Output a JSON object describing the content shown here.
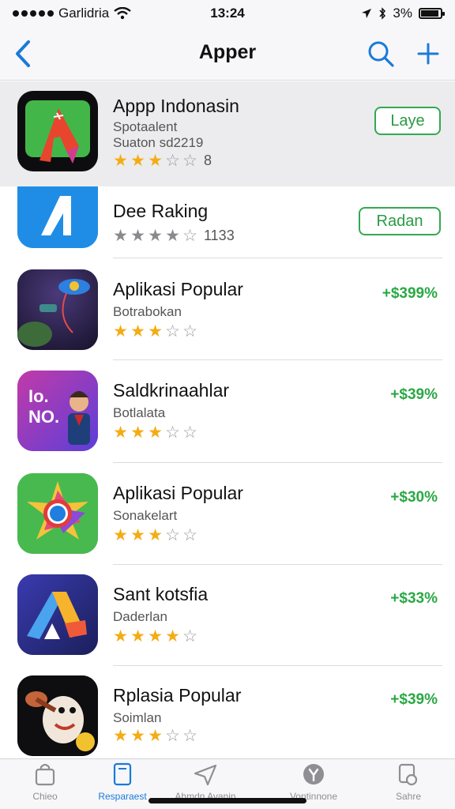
{
  "status_bar": {
    "carrier": "Garlidria",
    "time": "13:24",
    "battery": "3%",
    "battery_level": 0.9
  },
  "nav": {
    "title": "Apper",
    "back_icon": "chevron-left-icon",
    "search_icon": "search-icon",
    "add_icon": "plus-icon",
    "accent": "#1a7ad9"
  },
  "apps": [
    {
      "name": "Appp Indonasin",
      "sub1": "Spotaalent",
      "sub2": "Suaton sd2219",
      "rating": 3,
      "rating_count": "8",
      "button": "Laye"
    },
    {
      "name": "Dee Raking",
      "rating": 4,
      "rating_count": "1133",
      "button": "Radan"
    },
    {
      "name": "Aplikasi Popular",
      "sub1": "Botrabokan",
      "rating": 3,
      "price": "+$399%"
    },
    {
      "name": "Saldkrinaahlar",
      "sub1": "Botlalata",
      "rating": 3,
      "price": "+$39%"
    },
    {
      "name": "Aplikasi Popular",
      "sub1": "Sonakelart",
      "rating": 3,
      "price": "+$30%"
    },
    {
      "name": "Sant kotsfia",
      "sub1": "Daderlan",
      "rating": 4,
      "price": "+$33%"
    },
    {
      "name": "Rplasia Popular",
      "sub1": "Soimlan",
      "rating": 3,
      "price": "+$39%"
    }
  ],
  "tabs": [
    {
      "label": "Chieo",
      "icon": "bag-icon"
    },
    {
      "label": "Resparaest",
      "icon": "tablet-icon"
    },
    {
      "label": "Ahmdn Avanin",
      "icon": "plane-icon"
    },
    {
      "label": "Vontinnone",
      "icon": "y-circle-icon"
    },
    {
      "label": "Sahre",
      "icon": "share-doc-icon"
    }
  ],
  "colors": {
    "green": "#2aa845",
    "star": "#f4ac14"
  }
}
